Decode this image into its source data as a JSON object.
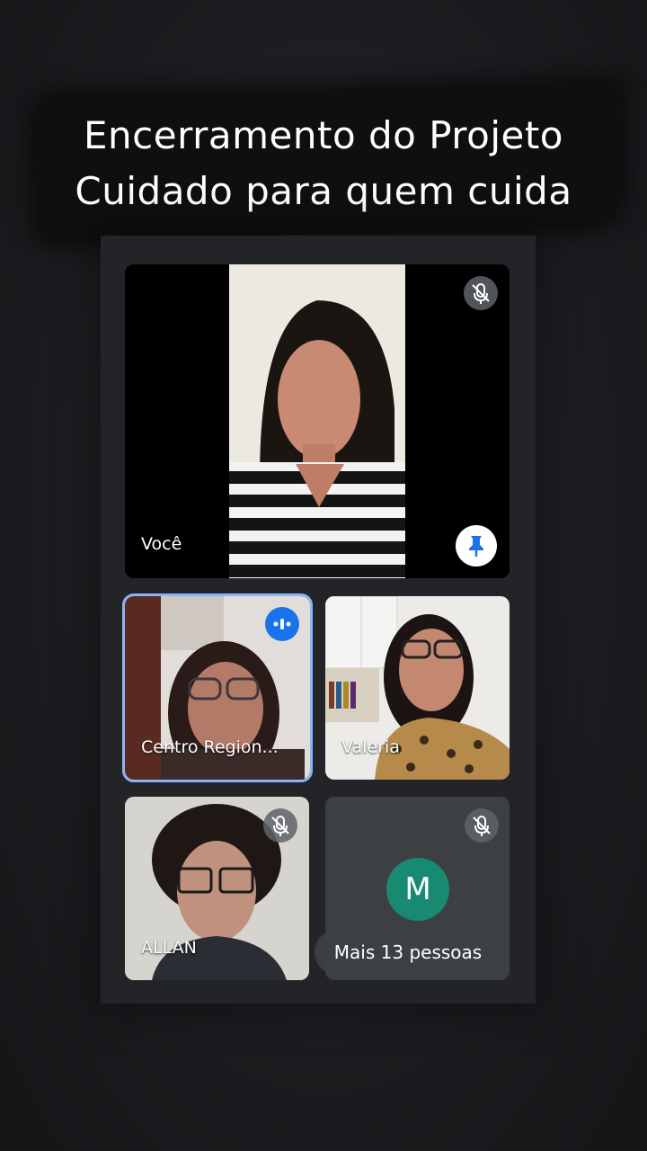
{
  "title": {
    "line1": "Encerramento do Projeto",
    "line2": "Cuidado para quem cuida"
  },
  "participants": [
    {
      "name": "Você",
      "mic": "muted",
      "pinned": true
    },
    {
      "name": "Centro Region...",
      "mic": "speaking"
    },
    {
      "name": "Valeria"
    },
    {
      "name": "ALLAN",
      "mic": "muted"
    }
  ],
  "overflow": {
    "avatar_letter": "M",
    "label": "Mais 13 pessoas",
    "mic": "muted"
  },
  "colors": {
    "active_border": "#8ab4f8",
    "speaking_badge": "#1a73e8",
    "avatar_bg": "#188a71",
    "tile_bg": "#3c4043"
  },
  "icons": [
    "mic-off-icon",
    "pin-icon",
    "speaking-icon"
  ]
}
